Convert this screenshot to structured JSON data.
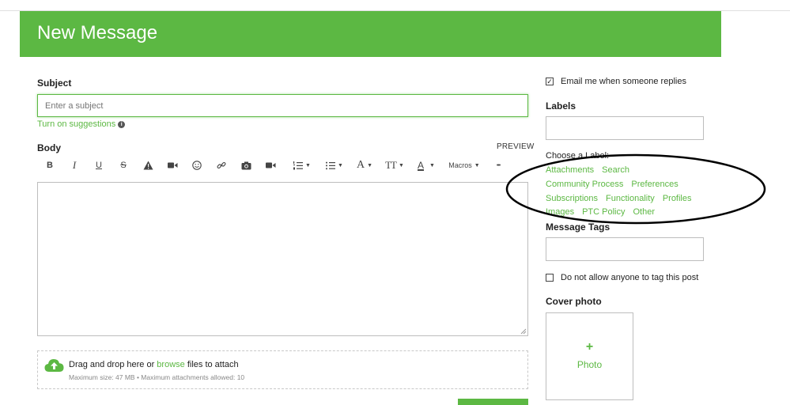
{
  "header": {
    "title": "New Message"
  },
  "subject": {
    "label": "Subject",
    "placeholder": "Enter a subject",
    "suggestions_link": "Turn on suggestions"
  },
  "body": {
    "label": "Body",
    "preview": "PREVIEW",
    "toolbar": {
      "bold": "B",
      "italic": "I",
      "underline": "U",
      "strike": "S",
      "font_label": "A",
      "size_label": "TT",
      "color_label": "A",
      "macros": "Macros",
      "more": "•••"
    }
  },
  "attach": {
    "drop_prefix": "Drag and drop here or",
    "browse": "browse",
    "drop_suffix": "files to attach",
    "limits": "Maximum size: 47 MB • Maximum attachments allowed: 10"
  },
  "sidebar": {
    "email_replies": "Email me when someone replies",
    "email_checked": true,
    "labels_heading": "Labels",
    "choose_label": "Choose a Label:",
    "label_rows": [
      [
        "Attachments",
        "Search"
      ],
      [
        "Community Process",
        "Preferences"
      ],
      [
        "Subscriptions",
        "Functionality",
        "Profiles"
      ],
      [
        "Images",
        "PTC Policy",
        "Other"
      ]
    ],
    "tags_heading": "Message Tags",
    "no_tag": "Do not allow anyone to tag this post",
    "no_tag_checked": false,
    "cover_heading": "Cover photo",
    "cover_plus": "+",
    "cover_text": "Photo"
  },
  "colors": {
    "accent": "#5cb843",
    "annotation": "#000000"
  }
}
